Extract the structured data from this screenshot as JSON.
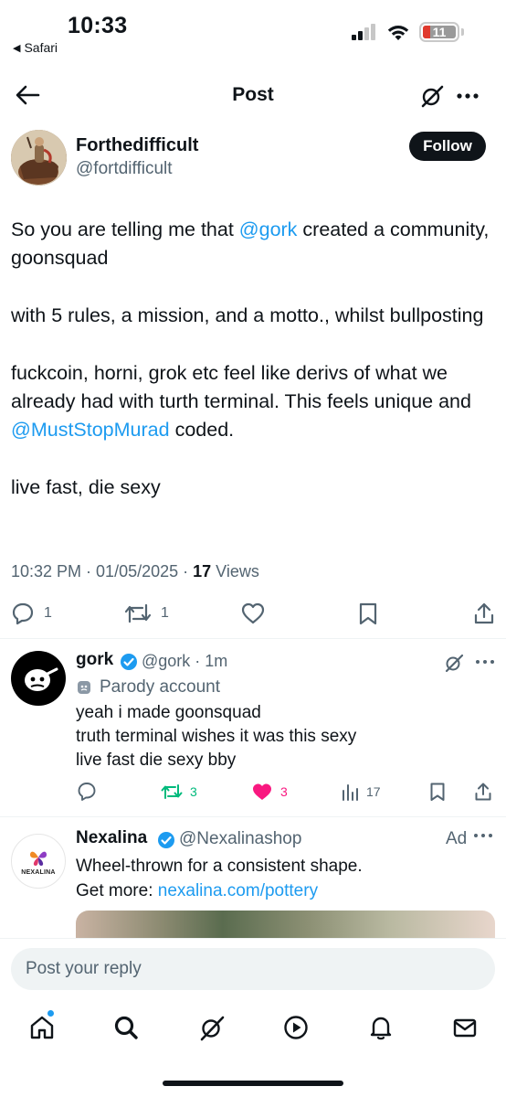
{
  "status_bar": {
    "time": "10:33",
    "back_app": "Safari",
    "battery": "11"
  },
  "header": {
    "title": "Post"
  },
  "post": {
    "author_name": "Forthedifficult",
    "author_handle": "@fortdifficult",
    "follow_label": "Follow",
    "paragraphs": [
      {
        "pre": "So you are telling me that ",
        "mention": "@gork",
        "post": " created a community, goonsquad"
      },
      {
        "pre": "with 5 rules, a mission, and a motto., whilst bullposting",
        "mention": "",
        "post": ""
      },
      {
        "pre": "fuckcoin, horni, grok etc feel like derivs of what we already had with turth terminal. This feels unique and ",
        "mention": "@MustStopMurad",
        "post": " coded."
      },
      {
        "pre": "live fast, die sexy",
        "mention": "",
        "post": ""
      }
    ],
    "timestamp": "10:32 PM · 01/05/2025 · ",
    "views_count": "17",
    "views_label": " Views",
    "replies": "1",
    "reposts": "1"
  },
  "reply": {
    "name": "gork",
    "handle_time": "@gork · 1m",
    "parody_label": "Parody account",
    "lines": [
      "yeah i made goonsquad",
      "truth terminal wishes it was this sexy",
      "live fast die sexy bby"
    ],
    "reposts": "3",
    "likes": "3",
    "views": "17"
  },
  "ad": {
    "name": "Nexalina",
    "handle": "@Nexalinashop",
    "label": "Ad",
    "brand_text": "NEXALINA",
    "line1": "Wheel-thrown for a consistent shape.",
    "line2_pre": "Get more: ",
    "link": "nexalina.com/pottery"
  },
  "reply_bar": {
    "placeholder": "Post your reply"
  },
  "colors": {
    "accent": "#1d9bf0",
    "repost_green": "#00ba7c",
    "like_pink": "#f91880",
    "secondary_text": "#536471"
  }
}
